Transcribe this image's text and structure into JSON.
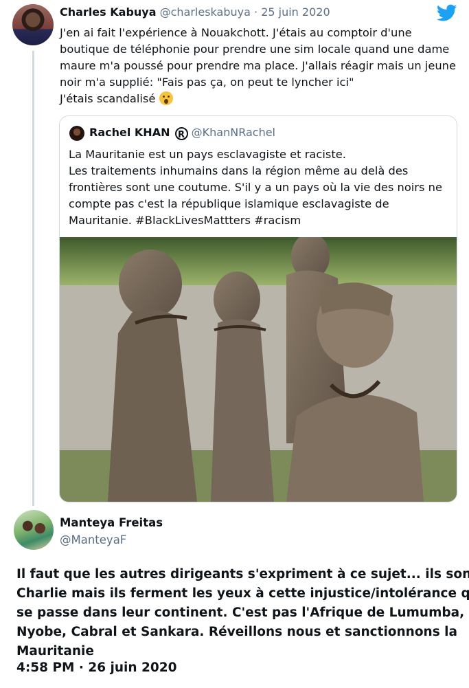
{
  "tweet1": {
    "author_name": "Charles Kabuya",
    "handle": "@charleskabuya",
    "separator": "·",
    "date": "25 juin 2020",
    "text_lines": [
      "J'en ai fait l'expérience à Nouakchott. J'étais au comptoir d'une",
      "boutique de téléphonie pour prendre une sim locale quand une dame",
      "maure m'a poussé pour prendre ma place. J'allais réagir mais un jeune",
      "noir m'a supplié: \"Fais pas ça, on peut te lyncher ici\"",
      "J'étais scandalisé"
    ]
  },
  "quoted": {
    "author_name": "Rachel KHAN",
    "registered_mark": "R",
    "handle": "@KhanNRachel",
    "text_lines": [
      "La Mauritanie est un pays esclavagiste et raciste.",
      "Les traitements inhumains dans la région même au delà des",
      "frontières sont une coutume. S'il y a un pays où la vie des noirs ne",
      "compte pas c'est la république islamique esclavagiste de",
      "Mauritanie. #BlackLivesMattters #racism"
    ]
  },
  "tweet2": {
    "author_name": "Manteya Freitas",
    "handle": "@ManteyaF",
    "text_lines": [
      "Il faut que les autres dirigeants s'expriment à ce sujet... ils sont",
      "Charlie mais ils ferment les yeux à cette injustice/intolérance qui",
      "se passe dans leur continent. C'est pas l'Afrique de Lumumba,",
      "Nyobe, Cabral et Sankara. Réveillons nous et sanctionnons la",
      "Mauritanie"
    ],
    "timestamp": "4:58 PM · 26 juin 2020"
  },
  "icons": {
    "brand": "twitter-bird-icon",
    "emoji": "astonished-face-emoji"
  },
  "colors": {
    "twitter_blue": "#1da1f2",
    "muted_text": "#5b7083",
    "border": "#cfd9de",
    "text": "#0f1419"
  }
}
